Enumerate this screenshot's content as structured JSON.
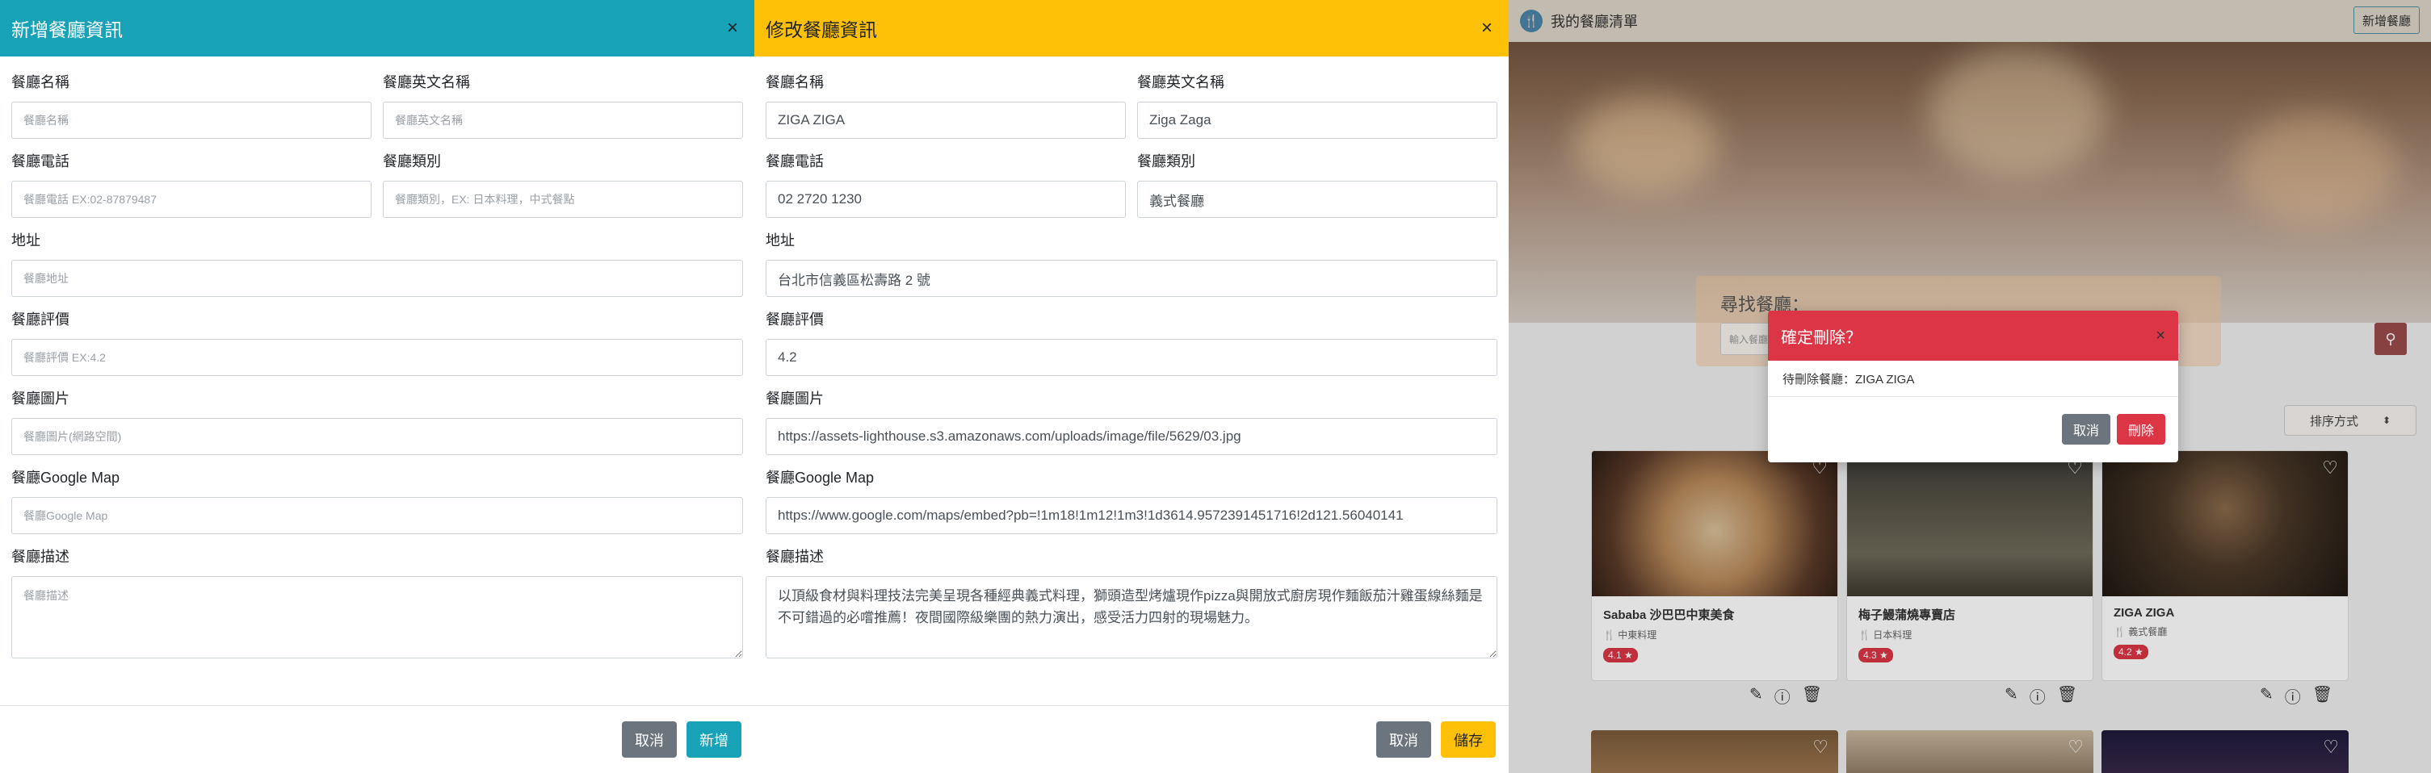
{
  "add_modal": {
    "title": "新增餐廳資訊",
    "fields": {
      "name": {
        "label": "餐廳名稱",
        "placeholder": "餐廳名稱",
        "value": ""
      },
      "name_en": {
        "label": "餐廳英文名稱",
        "placeholder": "餐廳英文名稱",
        "value": ""
      },
      "phone": {
        "label": "餐廳電話",
        "placeholder": "餐廳電話 EX:02-87879487",
        "value": ""
      },
      "category": {
        "label": "餐廳類別",
        "placeholder": "餐廳類別，EX: 日本料理，中式餐點",
        "value": ""
      },
      "address": {
        "label": "地址",
        "placeholder": "餐廳地址",
        "value": ""
      },
      "rating": {
        "label": "餐廳評價",
        "placeholder": "餐廳評價 EX:4.2",
        "value": ""
      },
      "image": {
        "label": "餐廳圖片",
        "placeholder": "餐廳圖片(網路空間)",
        "value": ""
      },
      "map": {
        "label": "餐廳Google Map",
        "placeholder": "餐廳Google Map",
        "value": ""
      },
      "desc": {
        "label": "餐廳描述",
        "placeholder": "餐廳描述",
        "value": ""
      }
    },
    "cancel_label": "取消",
    "submit_label": "新增"
  },
  "edit_modal": {
    "title": "修改餐廳資訊",
    "fields": {
      "name": {
        "label": "餐廳名稱",
        "value": "ZIGA ZIGA"
      },
      "name_en": {
        "label": "餐廳英文名稱",
        "value": "Ziga Zaga"
      },
      "phone": {
        "label": "餐廳電話",
        "value": "02 2720 1230"
      },
      "category": {
        "label": "餐廳類別",
        "value": "義式餐廳"
      },
      "address": {
        "label": "地址",
        "value": "台北市信義區松壽路 2 號"
      },
      "rating": {
        "label": "餐廳評價",
        "value": "4.2"
      },
      "image": {
        "label": "餐廳圖片",
        "value": "https://assets-lighthouse.s3.amazonaws.com/uploads/image/file/5629/03.jpg"
      },
      "map": {
        "label": "餐廳Google Map",
        "value": "https://www.google.com/maps/embed?pb=!1m18!1m12!1m3!1d3614.9572391451716!2d121.56040141"
      },
      "desc": {
        "label": "餐廳描述",
        "value": "以頂級食材與料理技法完美呈現各種經典義式料理，獅頭造型烤爐現作pizza與開放式廚房現作麵飯茄汁雞蛋線絲麵是不可錯過的必嚐推薦！夜間國際級樂團的熱力演出，感受活力四射的現場魅力。"
      }
    },
    "cancel_label": "取消",
    "submit_label": "儲存"
  },
  "list_page": {
    "brand": "我的餐廳清單",
    "add_button": "新增餐廳",
    "search_label": "尋找餐廳：",
    "search_placeholder": "輸入餐廳",
    "sort_label": "排序方式",
    "cards": [
      {
        "name": "Sababa 沙巴巴中東美食",
        "category": "中東料理",
        "rating": "4.1"
      },
      {
        "name": "梅子鰻蒲燒專賣店",
        "category": "日本料理",
        "rating": "4.3"
      },
      {
        "name": "ZIGA ZIGA",
        "category": "義式餐廳",
        "rating": "4.2"
      }
    ]
  },
  "delete_dialog": {
    "title": "確定刪除？",
    "message": "待刪除餐廳：ZIGA ZIGA",
    "cancel_label": "取消",
    "delete_label": "刪除"
  },
  "colors": {
    "add_header": "#17a2b8",
    "edit_header": "#ffc107",
    "delete_header": "#dc3545",
    "cancel": "#6c757d"
  },
  "icons": [
    "close-icon",
    "utensils-icon",
    "search-icon",
    "heart-icon",
    "edit-icon",
    "info-icon",
    "trash-icon",
    "star-icon",
    "chevron-icon"
  ]
}
